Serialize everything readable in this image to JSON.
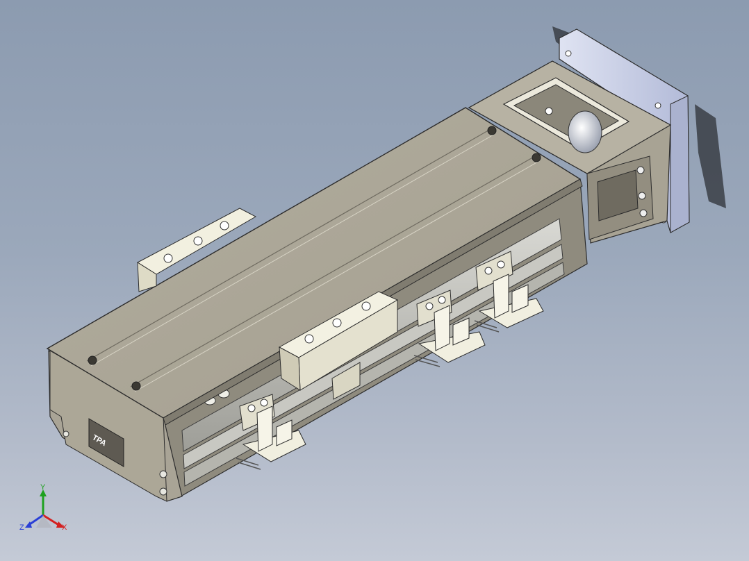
{
  "viewport": {
    "background_top": "#8c9bb0",
    "background_bottom": "#c4cad6"
  },
  "model": {
    "body_color": "#ada899",
    "block_color": "#ece9d6",
    "flange_color": "#c9d0e8",
    "logo_text": "TPA"
  },
  "triad": {
    "x_label": "X",
    "y_label": "Y",
    "z_label": "Z",
    "x_color": "#d42020",
    "y_color": "#1ea11e",
    "z_color": "#2a3fd6"
  }
}
